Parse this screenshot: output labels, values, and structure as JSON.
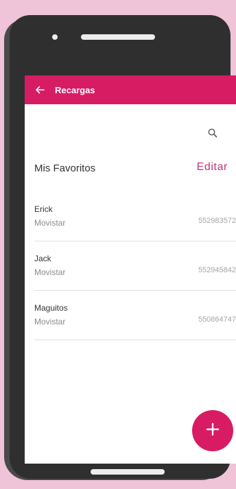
{
  "colors": {
    "background": "#efc3d8",
    "phone_body": "#2f2f2f",
    "app_bar": "#d81c64",
    "accent_text": "#c0357a",
    "fab": "#d81c64"
  },
  "appbar": {
    "title": "Recargas",
    "back_icon": "arrow-left-icon"
  },
  "toolbar": {
    "search_icon": "search-icon"
  },
  "favorites": {
    "title": "Mis Favoritos",
    "edit_label": "Editar",
    "items": [
      {
        "name": "Erick",
        "carrier": "Movistar",
        "number": "552983572"
      },
      {
        "name": "Jack",
        "carrier": "Movistar",
        "number": "552945842"
      },
      {
        "name": "Maguitos",
        "carrier": "Movistar",
        "number": "550864747"
      }
    ]
  },
  "fab": {
    "icon": "plus-icon"
  }
}
